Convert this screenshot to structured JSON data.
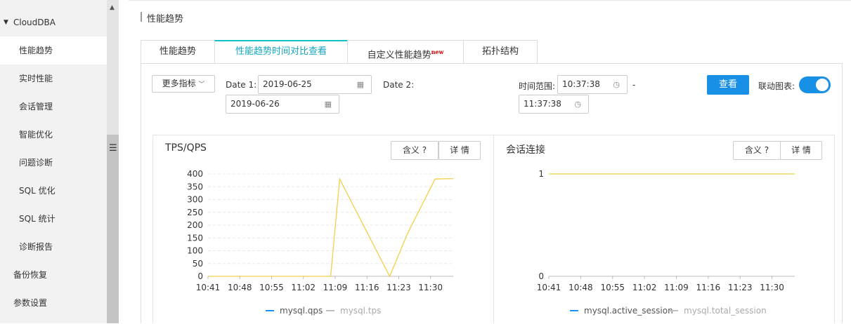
{
  "sidebar": {
    "group": "CloudDBA",
    "items": [
      "性能趋势",
      "实时性能",
      "会话管理",
      "智能优化",
      "问题诊断",
      "SQL 优化",
      "SQL 统计",
      "诊断报告"
    ],
    "active_index": 0,
    "bottom_items": [
      "备份恢复",
      "参数设置"
    ]
  },
  "page": {
    "title": "性能趋势",
    "tabs": [
      {
        "label": "性能趋势"
      },
      {
        "label": "性能趋势时间对比查看"
      },
      {
        "label": "自定义性能趋势",
        "badge": "new"
      },
      {
        "label": "拓扑结构"
      }
    ],
    "active_tab": 1
  },
  "toolbar": {
    "more_metrics": "更多指标",
    "date1_label": "Date 1:",
    "date1_value": "2019-06-25",
    "date2_label": "Date 2:",
    "date2_value": "2019-06-26",
    "time_range_label": "时间范围:",
    "time_start": "10:37:38",
    "time_separator": "-",
    "time_end": "11:37:38",
    "view_button": "查看",
    "linked_label": "联动图表:",
    "linked_on": true
  },
  "chart_data": [
    {
      "type": "line",
      "title": "TPS/QPS",
      "buttons": {
        "meaning": "含义 ?",
        "detail": "详 情"
      },
      "x_ticks": [
        "10:41",
        "10:48",
        "10:55",
        "11:02",
        "11:09",
        "11:16",
        "11:23",
        "11:30"
      ],
      "y_ticks": [
        0,
        50,
        100,
        150,
        200,
        250,
        300,
        350,
        400
      ],
      "ylim": [
        0,
        400
      ],
      "grid": true,
      "legend_position": "bottom",
      "series": [
        {
          "name": "mysql.qps",
          "color": "#1890ff",
          "x": [],
          "values": []
        },
        {
          "name": "mysql.tps",
          "color": "#f0d04a",
          "x": [
            "10:41",
            "11:02",
            "11:08",
            "11:10",
            "11:21",
            "11:25",
            "11:31",
            "11:35"
          ],
          "values": [
            0,
            0,
            0,
            380,
            0,
            170,
            380,
            382
          ]
        }
      ]
    },
    {
      "type": "line",
      "title": "会话连接",
      "buttons": {
        "meaning": "含义 ?",
        "detail": "详 情"
      },
      "x_ticks": [
        "10:41",
        "10:48",
        "10:55",
        "11:02",
        "11:09",
        "11:16",
        "11:23",
        "11:30"
      ],
      "y_ticks": [
        0,
        1
      ],
      "ylim": [
        0,
        1
      ],
      "grid": true,
      "legend_position": "bottom",
      "series": [
        {
          "name": "mysql.active_session",
          "color": "#1890ff",
          "x": [],
          "values": []
        },
        {
          "name": "mysql.total_session",
          "color": "#f0d04a",
          "x": [
            "10:41",
            "11:35"
          ],
          "values": [
            1,
            1
          ]
        }
      ]
    }
  ],
  "colors": {
    "accent": "#1890e6",
    "active_tab": "#13c2c2",
    "line": "#f0d04a",
    "legend_qps": "#1890ff",
    "legend_tps": "#bfbfbf"
  }
}
